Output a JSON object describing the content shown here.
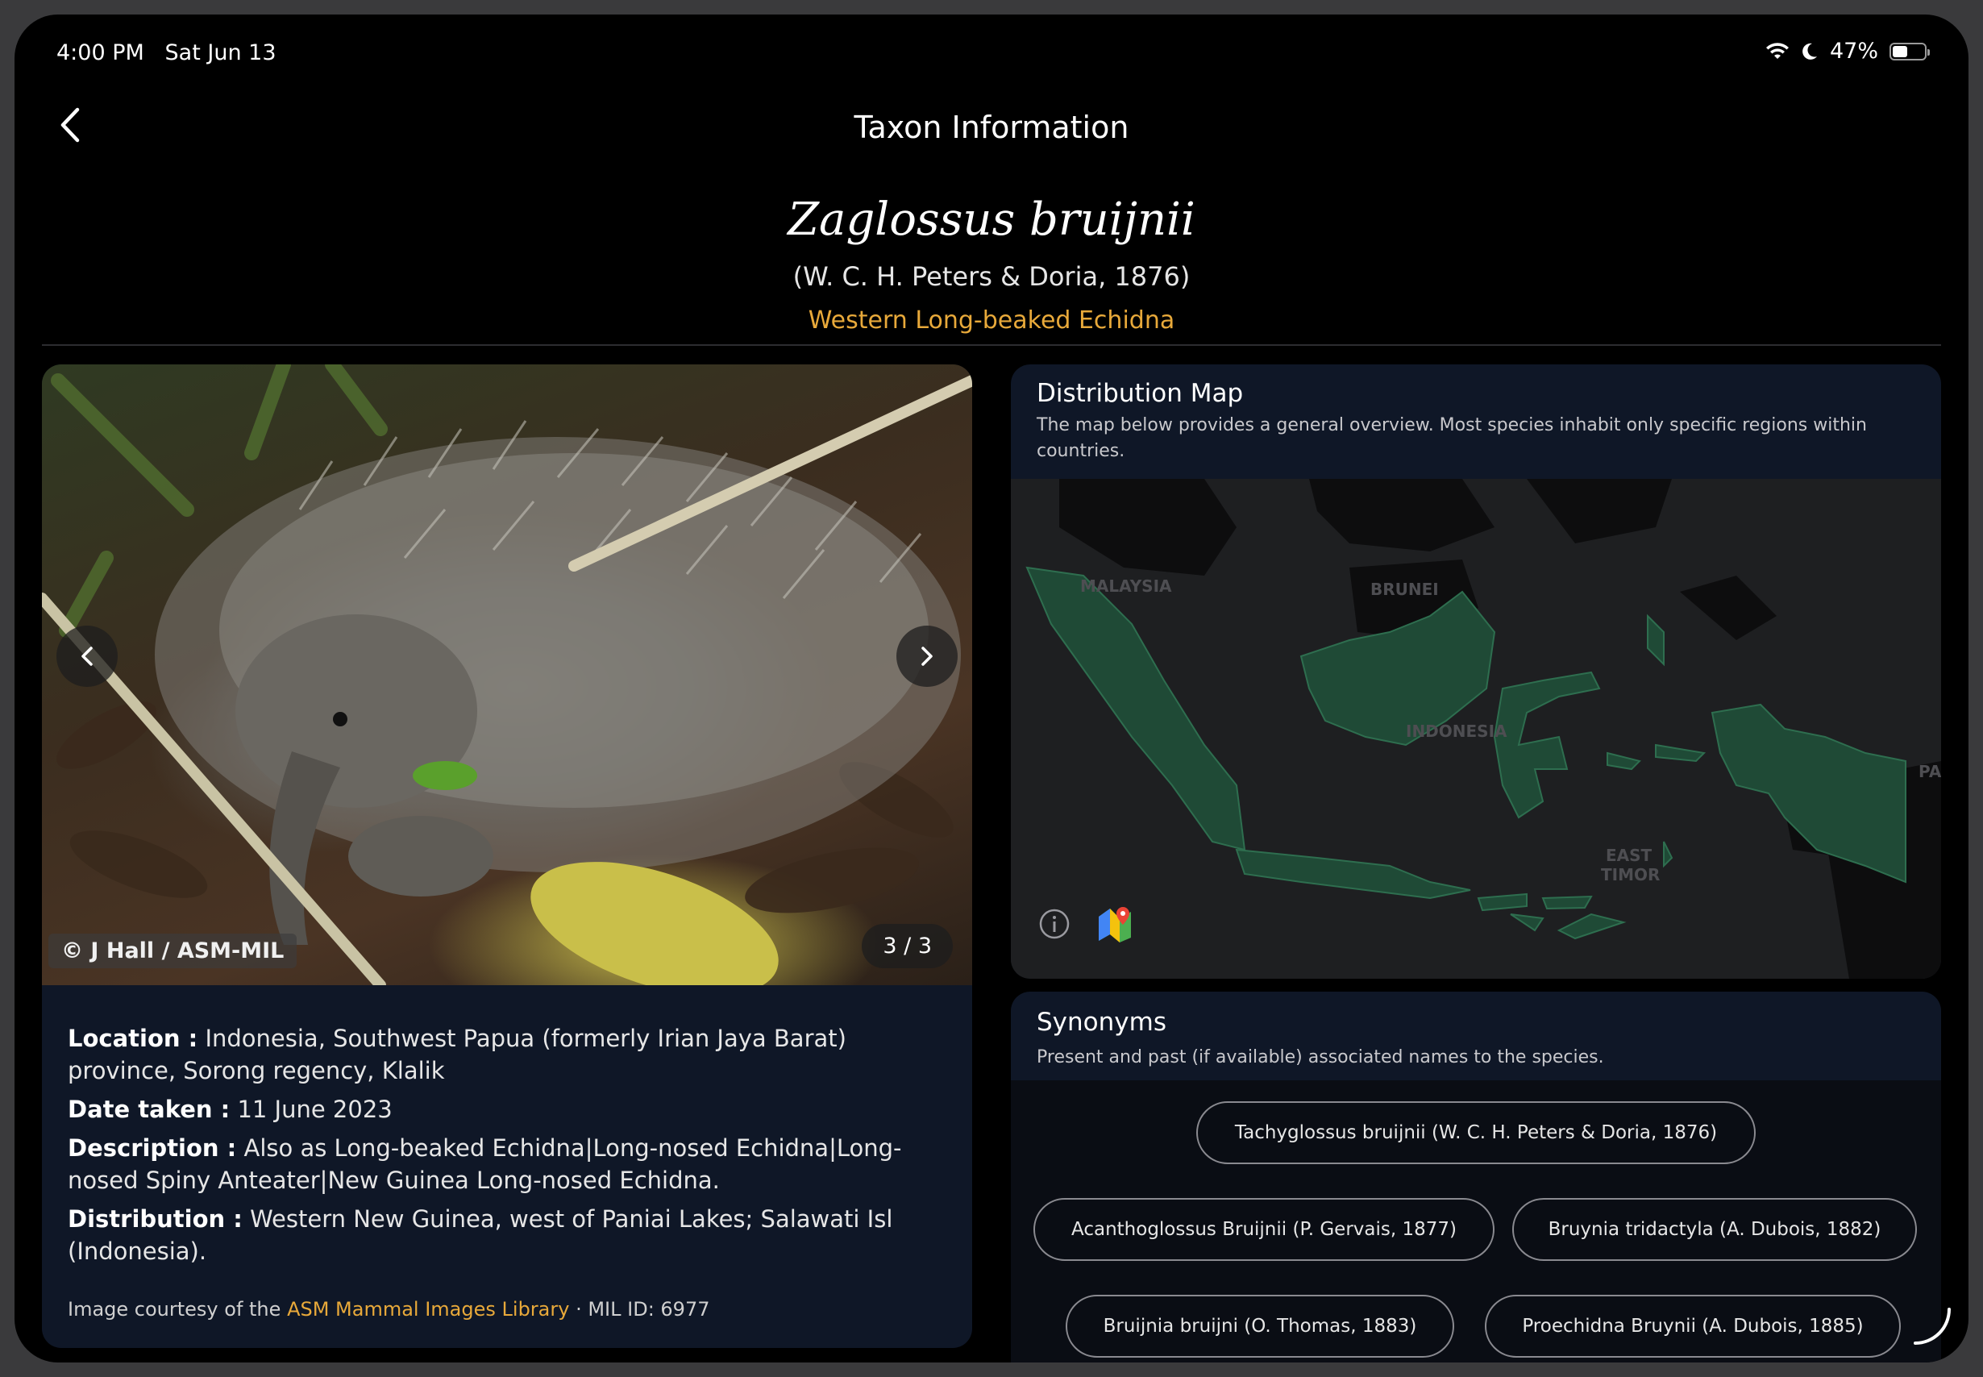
{
  "status_bar": {
    "time": "4:00 PM",
    "date": "Sat Jun 13",
    "battery": "47%"
  },
  "nav": {
    "title": "Taxon Information"
  },
  "taxon": {
    "scientific_name": "Zaglossus bruijnii",
    "authority": "(W. C. H. Peters & Doria, 1876)",
    "common_name": "Western Long-beaked Echidna"
  },
  "photo": {
    "credit": "© J Hall / ASM-MIL",
    "counter": "3 / 3"
  },
  "details": {
    "location_label": "Location :",
    "location": "Indonesia, Southwest Papua (formerly Irian Jaya Barat) province, Sorong regency, Klalik",
    "date_label": "Date taken :",
    "date": "11 June 2023",
    "description_label": "Description :",
    "description": "Also as Long-beaked Echidna|Long-nosed Echidna|Long-nosed Spiny Anteater|New Guinea Long-nosed Echidna.",
    "distribution_label": "Distribution :",
    "distribution": "Western New Guinea, west of Paniai Lakes; Salawati Isl (Indonesia)."
  },
  "courtesy": {
    "prefix": "Image courtesy of the",
    "link": "ASM Mammal Images Library",
    "suffix": "· MIL ID: 6977"
  },
  "map": {
    "title": "Distribution Map",
    "subtitle": "The map below provides a general overview. Most species inhabit only specific regions within countries.",
    "labels": {
      "malaysia": "MALAYSIA",
      "brunei": "BRUNEI",
      "indonesia": "INDONESIA",
      "east": "EAST",
      "timor": "TIMOR",
      "pa": "PA"
    },
    "land_color": "#0d0d0e",
    "water_color": "#1e1f21",
    "highlight_color": "#1f4a36"
  },
  "synonyms": {
    "title": "Synonyms",
    "subtitle": "Present and past (if available) associated names to the species.",
    "items": [
      "Tachyglossus bruijnii (W. C. H. Peters & Doria, 1876)",
      "Acanthoglossus Bruijnii (P. Gervais, 1877)",
      "Bruynia tridactyla (A. Dubois, 1882)",
      "Bruijnia bruijni (O. Thomas, 1883)",
      "Proechidna Bruynii (A. Dubois, 1885)"
    ]
  }
}
